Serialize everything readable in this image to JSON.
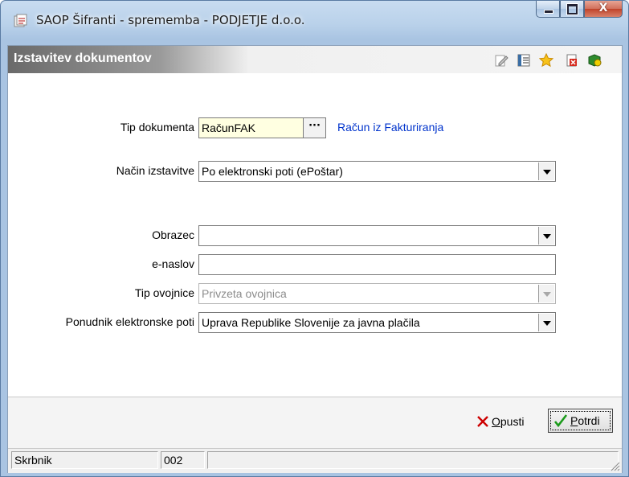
{
  "window": {
    "title": "SAOP Šifranti - sprememba - PODJETJE d.o.o.",
    "close_glyph": "X"
  },
  "header": {
    "title": "Izstavitev dokumentov",
    "toolbar_icons": [
      "edit-icon",
      "list-icon",
      "star-icon",
      "delete-icon",
      "help-icon"
    ]
  },
  "form": {
    "tip_dokumenta": {
      "label": "Tip dokumenta",
      "value": "RačunFAK",
      "button": "···",
      "description": "Račun iz Fakturiranja"
    },
    "nacin_izstavitve": {
      "label": "Način izstavitve",
      "value": "Po elektronski poti (ePoštar)"
    },
    "obrazec": {
      "label": "Obrazec",
      "value": ""
    },
    "e_naslov": {
      "label": "e-naslov",
      "value": ""
    },
    "tip_ovojnice": {
      "label": "Tip ovojnice",
      "value": "Privzeta ovojnica"
    },
    "ponudnik": {
      "label": "Ponudnik elektronske poti",
      "value": "Uprava Republike Slovenije za javna plačila"
    }
  },
  "buttons": {
    "cancel_prefix": "O",
    "cancel_rest": "pusti",
    "confirm_prefix": "P",
    "confirm_rest": "otrdi"
  },
  "status": {
    "user": "Skrbnik",
    "code": "002"
  },
  "colors": {
    "link": "#0033cc",
    "cancel_icon": "#cc0000",
    "confirm_icon": "#1a9a1a",
    "highlight_field": "#ffffe1"
  }
}
